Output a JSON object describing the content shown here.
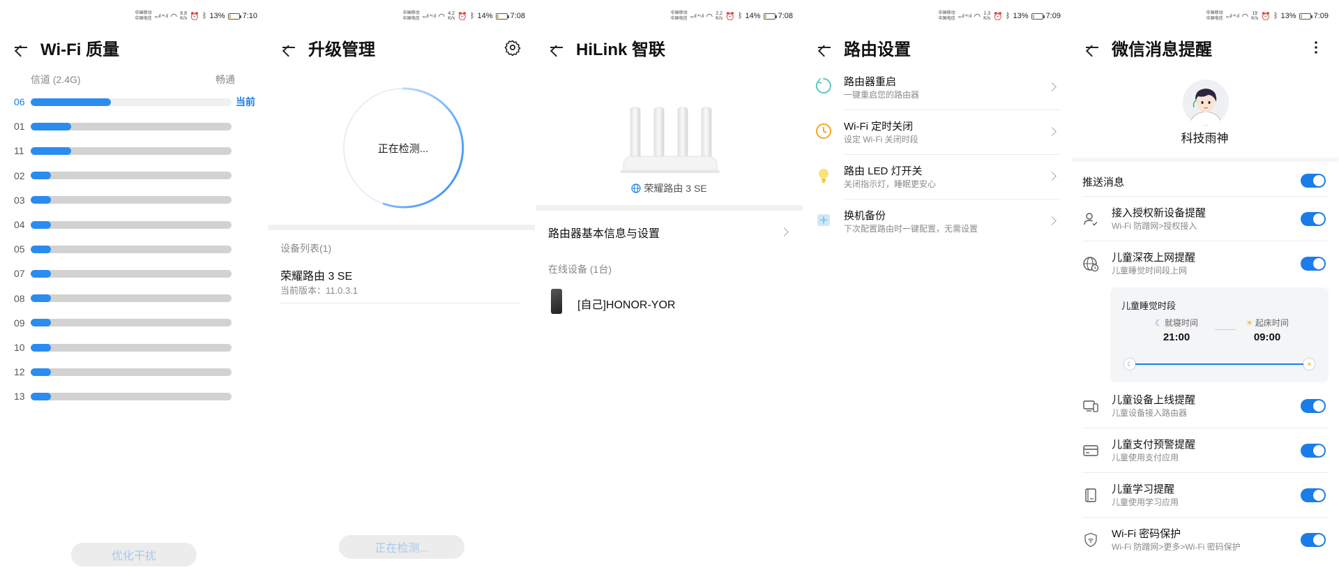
{
  "status_bars": [
    {
      "carrier1": "中国移动",
      "carrier2": "中国电信",
      "speed": "8.8",
      "speed_unit": "K/s",
      "battery": "13%",
      "time": "7:10",
      "battery_fill": 0.13
    },
    {
      "carrier1": "中国移动",
      "carrier2": "中国电信",
      "speed": "4.2",
      "speed_unit": "K/s",
      "battery": "14%",
      "time": "7:08",
      "battery_fill": 0.14
    },
    {
      "carrier1": "中国移动",
      "carrier2": "中国电信",
      "speed": "2.2",
      "speed_unit": "K/s",
      "battery": "14%",
      "time": "7:08",
      "battery_fill": 0.14
    },
    {
      "carrier1": "中国移动",
      "carrier2": "中国电信",
      "speed": "1.3",
      "speed_unit": "K/s",
      "battery": "13%",
      "time": "7:09",
      "battery_fill": 0.13
    },
    {
      "carrier1": "中国移动",
      "carrier2": "中国电信",
      "speed": "19",
      "speed_unit": "K/s",
      "battery": "13%",
      "time": "7:09",
      "battery_fill": 0.13
    }
  ],
  "wifi_quality": {
    "title": "Wi-Fi 质量",
    "channel_label": "信道 (2.4G)",
    "status_label": "畅通",
    "current_label": "当前",
    "button_label": "优化干扰",
    "channels": [
      {
        "num": "06",
        "level": 0.4,
        "current": true
      },
      {
        "num": "01",
        "level": 0.2
      },
      {
        "num": "11",
        "level": 0.2
      },
      {
        "num": "02",
        "level": 0.1
      },
      {
        "num": "03",
        "level": 0.1
      },
      {
        "num": "04",
        "level": 0.1
      },
      {
        "num": "05",
        "level": 0.1
      },
      {
        "num": "07",
        "level": 0.1
      },
      {
        "num": "08",
        "level": 0.1
      },
      {
        "num": "09",
        "level": 0.1
      },
      {
        "num": "10",
        "level": 0.1
      },
      {
        "num": "12",
        "level": 0.1
      },
      {
        "num": "13",
        "level": 0.1
      }
    ]
  },
  "upgrade": {
    "title": "升级管理",
    "checking_text": "正在检测...",
    "device_list_label": "设备列表(1)",
    "device_name": "荣耀路由 3 SE",
    "device_version": "当前版本：11.0.3.1",
    "button_label": "正在检测..."
  },
  "hilink": {
    "title": "HiLink 智联",
    "router_name": "荣耀路由 3 SE",
    "basic_info_label": "路由器基本信息与设置",
    "online_label": "在线设备 (1台)",
    "device_name": "[自己]HONOR-YOR"
  },
  "router_settings": {
    "title": "路由设置",
    "items": [
      {
        "title": "路由器重启",
        "desc": "一键重启您的路由器",
        "icon": "restart-icon",
        "color": "#5cc9c0"
      },
      {
        "title": "Wi-Fi 定时关闭",
        "desc": "设定 Wi-Fi 关闭时段",
        "icon": "timer-icon",
        "color": "#f5a623"
      },
      {
        "title": "路由 LED 灯开关",
        "desc": "关闭指示灯，睡眠更安心",
        "icon": "bulb-icon",
        "color": "#f7d84a"
      },
      {
        "title": "换机备份",
        "desc": "下次配置路由时一键配置，无需设置",
        "icon": "backup-icon",
        "color": "#7cc3ef"
      }
    ]
  },
  "wechat_notify": {
    "title": "微信消息提醒",
    "nickname": "科技雨神",
    "push_label": "推送消息",
    "items": [
      {
        "title": "接入授权新设备提醒",
        "desc": "Wi-Fi 防蹭网>授权接入",
        "icon": "user-check-icon",
        "on": true
      },
      {
        "title": "儿童深夜上网提醒",
        "desc": "儿童睡觉时间段上网",
        "icon": "globe-clock-icon",
        "on": true
      }
    ],
    "sleep": {
      "title": "儿童睡觉时段",
      "bed_label": "就寝时间",
      "bed_time": "21:00",
      "wake_label": "起床时间",
      "wake_time": "09:00"
    },
    "items2": [
      {
        "title": "儿童设备上线提醒",
        "desc": "儿童设备接入路由器",
        "icon": "devices-icon",
        "on": true
      },
      {
        "title": "儿童支付预警提醒",
        "desc": "儿童使用支付应用",
        "icon": "card-icon",
        "on": true
      },
      {
        "title": "儿童学习提醒",
        "desc": "儿童使用学习应用",
        "icon": "book-icon",
        "on": true
      },
      {
        "title": "Wi-Fi 密码保护",
        "desc": "Wi-Fi 防蹭网>更多>Wi-Fi 密码保护",
        "icon": "shield-icon",
        "on": true
      }
    ]
  },
  "colors": {
    "accent": "#1a7de8",
    "bar_fill": "#2a8cf0",
    "bar_track": "#d2d2d2"
  }
}
